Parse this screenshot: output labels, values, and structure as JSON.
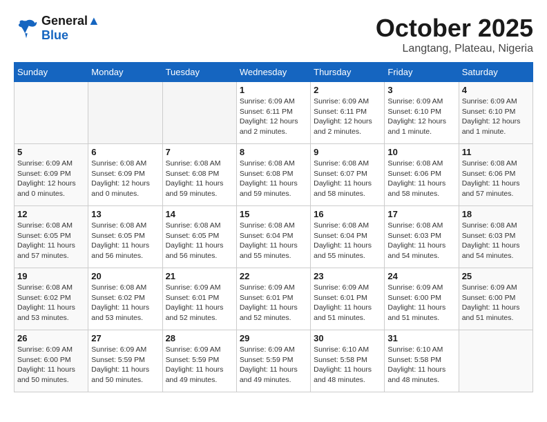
{
  "logo": {
    "line1": "General",
    "line2": "Blue"
  },
  "title": {
    "month_year": "October 2025",
    "location": "Langtang, Plateau, Nigeria"
  },
  "headers": [
    "Sunday",
    "Monday",
    "Tuesday",
    "Wednesday",
    "Thursday",
    "Friday",
    "Saturday"
  ],
  "weeks": [
    [
      {
        "day": "",
        "info": ""
      },
      {
        "day": "",
        "info": ""
      },
      {
        "day": "",
        "info": ""
      },
      {
        "day": "1",
        "info": "Sunrise: 6:09 AM\nSunset: 6:11 PM\nDaylight: 12 hours\nand 2 minutes."
      },
      {
        "day": "2",
        "info": "Sunrise: 6:09 AM\nSunset: 6:11 PM\nDaylight: 12 hours\nand 2 minutes."
      },
      {
        "day": "3",
        "info": "Sunrise: 6:09 AM\nSunset: 6:10 PM\nDaylight: 12 hours\nand 1 minute."
      },
      {
        "day": "4",
        "info": "Sunrise: 6:09 AM\nSunset: 6:10 PM\nDaylight: 12 hours\nand 1 minute."
      }
    ],
    [
      {
        "day": "5",
        "info": "Sunrise: 6:09 AM\nSunset: 6:09 PM\nDaylight: 12 hours\nand 0 minutes."
      },
      {
        "day": "6",
        "info": "Sunrise: 6:08 AM\nSunset: 6:09 PM\nDaylight: 12 hours\nand 0 minutes."
      },
      {
        "day": "7",
        "info": "Sunrise: 6:08 AM\nSunset: 6:08 PM\nDaylight: 11 hours\nand 59 minutes."
      },
      {
        "day": "8",
        "info": "Sunrise: 6:08 AM\nSunset: 6:08 PM\nDaylight: 11 hours\nand 59 minutes."
      },
      {
        "day": "9",
        "info": "Sunrise: 6:08 AM\nSunset: 6:07 PM\nDaylight: 11 hours\nand 58 minutes."
      },
      {
        "day": "10",
        "info": "Sunrise: 6:08 AM\nSunset: 6:06 PM\nDaylight: 11 hours\nand 58 minutes."
      },
      {
        "day": "11",
        "info": "Sunrise: 6:08 AM\nSunset: 6:06 PM\nDaylight: 11 hours\nand 57 minutes."
      }
    ],
    [
      {
        "day": "12",
        "info": "Sunrise: 6:08 AM\nSunset: 6:05 PM\nDaylight: 11 hours\nand 57 minutes."
      },
      {
        "day": "13",
        "info": "Sunrise: 6:08 AM\nSunset: 6:05 PM\nDaylight: 11 hours\nand 56 minutes."
      },
      {
        "day": "14",
        "info": "Sunrise: 6:08 AM\nSunset: 6:05 PM\nDaylight: 11 hours\nand 56 minutes."
      },
      {
        "day": "15",
        "info": "Sunrise: 6:08 AM\nSunset: 6:04 PM\nDaylight: 11 hours\nand 55 minutes."
      },
      {
        "day": "16",
        "info": "Sunrise: 6:08 AM\nSunset: 6:04 PM\nDaylight: 11 hours\nand 55 minutes."
      },
      {
        "day": "17",
        "info": "Sunrise: 6:08 AM\nSunset: 6:03 PM\nDaylight: 11 hours\nand 54 minutes."
      },
      {
        "day": "18",
        "info": "Sunrise: 6:08 AM\nSunset: 6:03 PM\nDaylight: 11 hours\nand 54 minutes."
      }
    ],
    [
      {
        "day": "19",
        "info": "Sunrise: 6:08 AM\nSunset: 6:02 PM\nDaylight: 11 hours\nand 53 minutes."
      },
      {
        "day": "20",
        "info": "Sunrise: 6:08 AM\nSunset: 6:02 PM\nDaylight: 11 hours\nand 53 minutes."
      },
      {
        "day": "21",
        "info": "Sunrise: 6:09 AM\nSunset: 6:01 PM\nDaylight: 11 hours\nand 52 minutes."
      },
      {
        "day": "22",
        "info": "Sunrise: 6:09 AM\nSunset: 6:01 PM\nDaylight: 11 hours\nand 52 minutes."
      },
      {
        "day": "23",
        "info": "Sunrise: 6:09 AM\nSunset: 6:01 PM\nDaylight: 11 hours\nand 51 minutes."
      },
      {
        "day": "24",
        "info": "Sunrise: 6:09 AM\nSunset: 6:00 PM\nDaylight: 11 hours\nand 51 minutes."
      },
      {
        "day": "25",
        "info": "Sunrise: 6:09 AM\nSunset: 6:00 PM\nDaylight: 11 hours\nand 51 minutes."
      }
    ],
    [
      {
        "day": "26",
        "info": "Sunrise: 6:09 AM\nSunset: 6:00 PM\nDaylight: 11 hours\nand 50 minutes."
      },
      {
        "day": "27",
        "info": "Sunrise: 6:09 AM\nSunset: 5:59 PM\nDaylight: 11 hours\nand 50 minutes."
      },
      {
        "day": "28",
        "info": "Sunrise: 6:09 AM\nSunset: 5:59 PM\nDaylight: 11 hours\nand 49 minutes."
      },
      {
        "day": "29",
        "info": "Sunrise: 6:09 AM\nSunset: 5:59 PM\nDaylight: 11 hours\nand 49 minutes."
      },
      {
        "day": "30",
        "info": "Sunrise: 6:10 AM\nSunset: 5:58 PM\nDaylight: 11 hours\nand 48 minutes."
      },
      {
        "day": "31",
        "info": "Sunrise: 6:10 AM\nSunset: 5:58 PM\nDaylight: 11 hours\nand 48 minutes."
      },
      {
        "day": "",
        "info": ""
      }
    ]
  ]
}
